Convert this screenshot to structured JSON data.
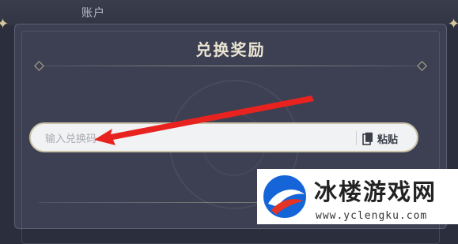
{
  "header": {
    "account_label": "账户"
  },
  "dialog": {
    "title": "兑换奖励",
    "code_input": {
      "value": "",
      "placeholder": "输入兑换码"
    },
    "paste_button": {
      "label": "粘贴",
      "icon": "clipboard-icon"
    }
  },
  "annotation": {
    "arrow_color": "#e8231f",
    "icon": "red-arrow-icon"
  },
  "watermark": {
    "title": "冰楼游戏网",
    "url": "www.yclengku.com",
    "logo_colors": {
      "blue": "#1565d8",
      "red": "#e53326"
    }
  },
  "colors": {
    "background": "#2b2f3d",
    "dialog": "#3c4052",
    "title_text": "#ece5d3",
    "input_border": "#c9c2a8"
  }
}
